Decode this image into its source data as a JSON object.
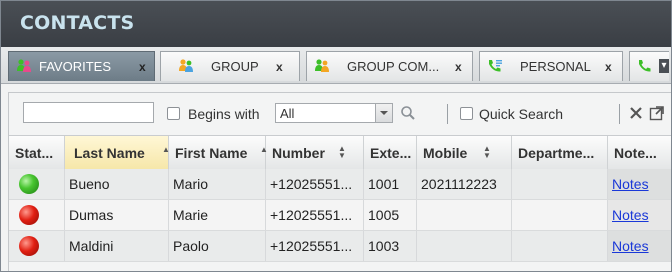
{
  "window": {
    "title": "CONTACTS"
  },
  "tabs": [
    {
      "label": "FAVORITES",
      "close": "x",
      "icon": "favorites-people-icon",
      "active": true
    },
    {
      "label": "GROUP",
      "close": "x",
      "icon": "group-people-icon",
      "active": false
    },
    {
      "label": "GROUP COM...",
      "close": "x",
      "icon": "group-common-icon",
      "active": false
    },
    {
      "label": "PERSONAL",
      "close": "x",
      "icon": "personal-phone-icon",
      "active": false
    }
  ],
  "toolbar": {
    "search_value": "",
    "begins_with_label": "Begins with",
    "combo_value": "All",
    "quick_search_label": "Quick Search"
  },
  "columns": [
    "Stat...",
    "Last Name",
    "First Name",
    "Number",
    "Exte...",
    "Mobile",
    "Departme...",
    "Note..."
  ],
  "rows": [
    {
      "status": "available",
      "last": "Bueno",
      "first": "Mario",
      "number": "+12025551...",
      "ext": "1001",
      "mobile": "2021112223",
      "department": "",
      "notes": "Notes"
    },
    {
      "status": "busy",
      "last": "Dumas",
      "first": "Marie",
      "number": "+12025551...",
      "ext": "1005",
      "mobile": "",
      "department": "",
      "notes": "Notes"
    },
    {
      "status": "busy",
      "last": "Maldini",
      "first": "Paolo",
      "number": "+12025551...",
      "ext": "1003",
      "mobile": "",
      "department": "",
      "notes": "Notes"
    }
  ],
  "colors": {
    "title_bar": "#3f444a",
    "title_text": "#c9e3ee",
    "active_tab": "#7b8a95",
    "sorted_header": "#f6e7a9",
    "link": "#1a38d8",
    "available": "#3cbf28",
    "busy": "#e11f12"
  }
}
